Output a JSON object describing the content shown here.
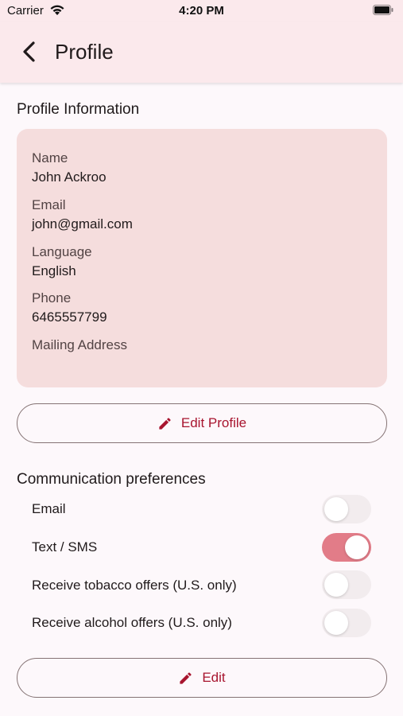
{
  "status_bar": {
    "carrier": "Carrier",
    "time": "4:20 PM"
  },
  "header": {
    "title": "Profile"
  },
  "profile_info": {
    "section_title": "Profile Information",
    "fields": [
      {
        "label": "Name",
        "value": "John Ackroo"
      },
      {
        "label": "Email",
        "value": "john@gmail.com"
      },
      {
        "label": "Language",
        "value": "English"
      },
      {
        "label": "Phone",
        "value": "6465557799"
      },
      {
        "label": "Mailing Address",
        "value": ""
      }
    ],
    "edit_button_label": "Edit Profile"
  },
  "communication": {
    "section_title": "Communication preferences",
    "items": [
      {
        "label": "Email",
        "enabled": false
      },
      {
        "label": "Text / SMS",
        "enabled": true
      },
      {
        "label": "Receive tobacco offers (U.S. only)",
        "enabled": false
      },
      {
        "label": "Receive alcohol offers (U.S. only)",
        "enabled": false
      }
    ],
    "edit_button_label": "Edit"
  },
  "colors": {
    "accent": "#a8152f",
    "header_bg": "#fbe9ec",
    "card_bg": "#f5dddd",
    "toggle_on": "#e27c88"
  },
  "icons": [
    "wifi-icon",
    "battery-icon",
    "back-arrow-icon",
    "pencil-icon"
  ]
}
